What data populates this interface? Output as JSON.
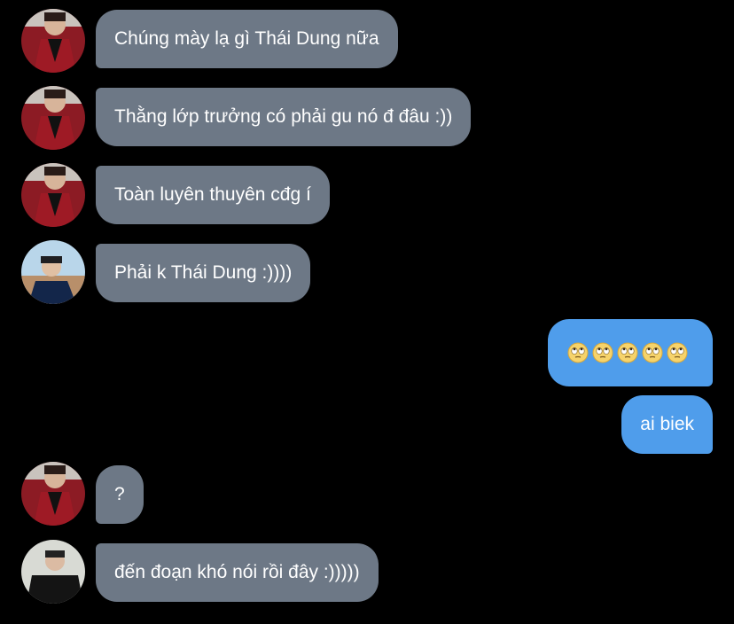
{
  "messages": [
    {
      "sender": "them",
      "avatar": "red-jacket-avatar",
      "text": "Chúng mày lạ gì Thái Dung nữa"
    },
    {
      "sender": "them",
      "avatar": "red-jacket-avatar",
      "text": "Thằng lớp trưởng có phải gu nó đ đâu :))"
    },
    {
      "sender": "them",
      "avatar": "red-jacket-avatar",
      "text": "Toàn luyên thuyên cđg í"
    },
    {
      "sender": "them",
      "avatar": "blue-shirt-avatar",
      "text": "Phải k Thái Dung :))))"
    },
    {
      "sender": "me",
      "text": "🙄🙄🙄🙄🙄"
    },
    {
      "sender": "me",
      "text": "ai biek"
    },
    {
      "sender": "them",
      "avatar": "red-jacket-avatar",
      "text": "?"
    },
    {
      "sender": "them",
      "avatar": "black-shirt-avatar",
      "text": "đến đoạn khó nói rồi đây :)))))"
    }
  ],
  "colors": {
    "background": "#000000",
    "incoming_bubble": "#6d7886",
    "outgoing_bubble": "#4f9deb",
    "text": "#ffffff"
  }
}
